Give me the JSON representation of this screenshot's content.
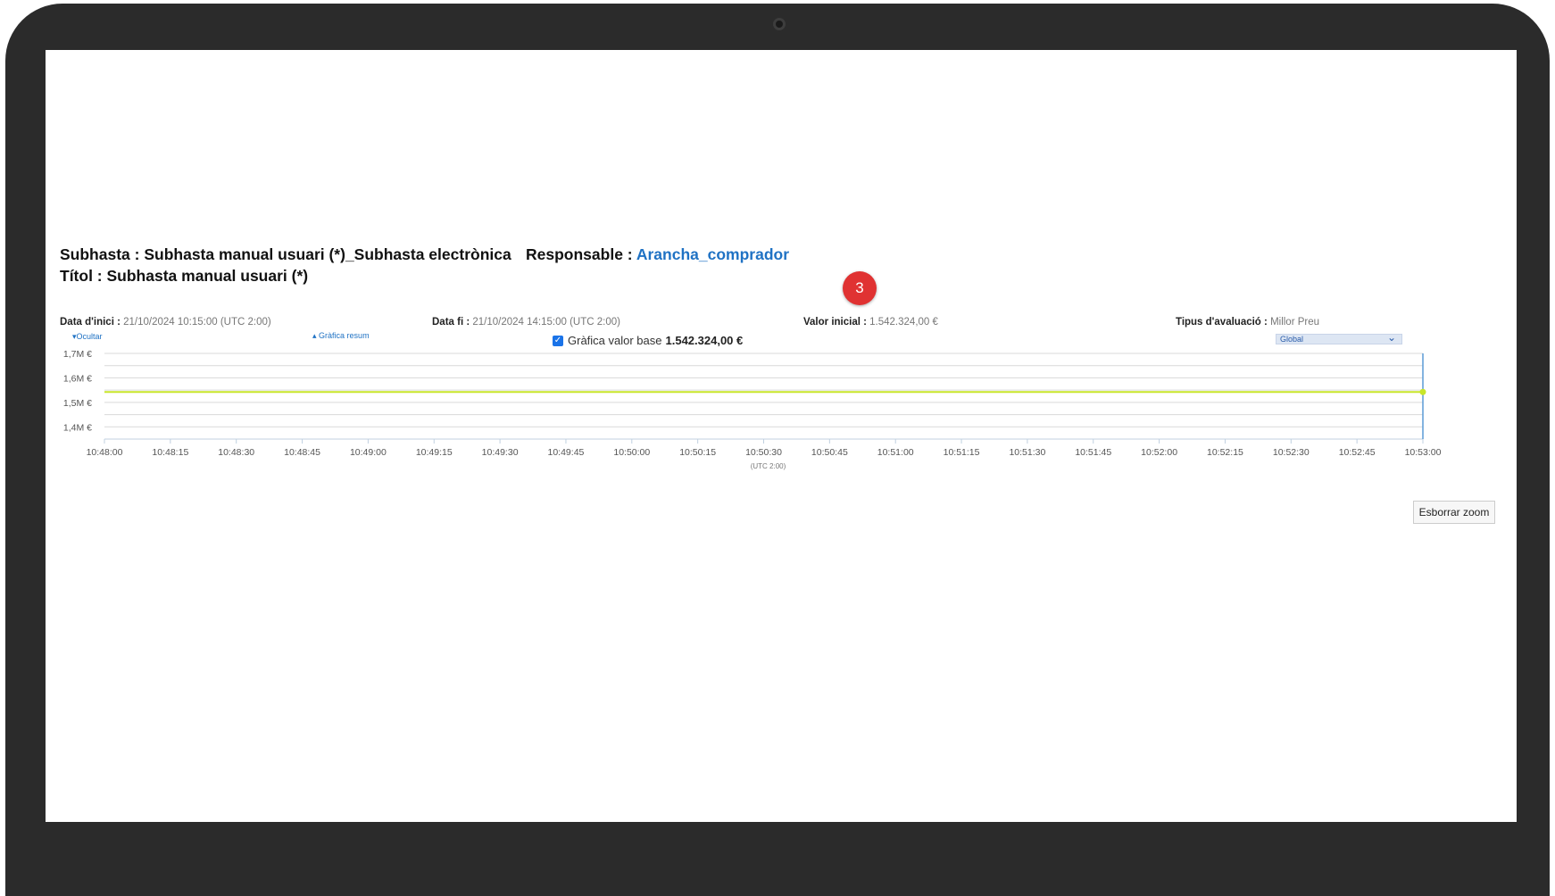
{
  "header": {
    "subasta_label": "Subhasta :",
    "subasta_value": "Subhasta manual usuari (*)_Subhasta electrònica",
    "responsable_label": "Responsable :",
    "responsable_value": "Arancha_comprador",
    "titol_label": "Títol :",
    "titol_value": "Subhasta manual usuari (*)",
    "step_badge": "3"
  },
  "meta": {
    "data_inici_label": "Data d'inici :",
    "data_inici_value": "21/10/2024 10:15:00 (UTC 2:00)",
    "data_fi_label": "Data fi :",
    "data_fi_value": "21/10/2024 14:15:00 (UTC 2:00)",
    "valor_inicial_label": "Valor inicial :",
    "valor_inicial_value": "1.542.324,00 €",
    "tipus_label": "Tipus d'avaluació :",
    "tipus_value": "Millor Preu"
  },
  "controls": {
    "ocultar_label": "Ocultar",
    "grafica_resum_label": "Gràfica resum",
    "valor_base_checkbox_label": "Gràfica valor base",
    "valor_base_checked": true,
    "valor_base_value": "1.542.324,00 €",
    "evaluation_select_value": "Global",
    "zoom_reset_label": "Esborrar zoom"
  },
  "chart_data": {
    "type": "line",
    "ytick_labels": [
      "1,7M €",
      "1,6M €",
      "1,5M €",
      "1,4M €"
    ],
    "ytick_values": [
      1700000,
      1600000,
      1500000,
      1400000
    ],
    "ylim": [
      1350000,
      1700000
    ],
    "x": [
      "10:48:00",
      "10:48:15",
      "10:48:30",
      "10:48:45",
      "10:49:00",
      "10:49:15",
      "10:49:30",
      "10:49:45",
      "10:50:00",
      "10:50:15",
      "10:50:30",
      "10:50:45",
      "10:51:00",
      "10:51:15",
      "10:51:30",
      "10:51:45",
      "10:52:00",
      "10:52:15",
      "10:52:30",
      "10:52:45",
      "10:53:00"
    ],
    "xlabel": "(UTC 2:00)",
    "series": [
      {
        "values": [
          1542324,
          1542324
        ],
        "x": [
          "10:48:00",
          "10:53:00"
        ],
        "color": "#c8e62a",
        "marker_at_end": true
      }
    ],
    "cursor_x": "10:53:00",
    "cursor_color": "#5b9bd5",
    "grid": true
  }
}
